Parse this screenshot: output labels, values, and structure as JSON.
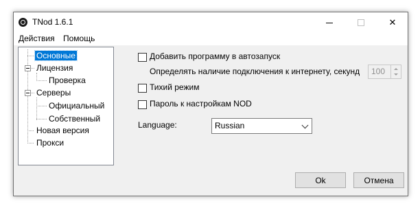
{
  "window": {
    "title": "TNod 1.6.1"
  },
  "menu": {
    "items": [
      "Действия",
      "Помощь"
    ]
  },
  "tree": {
    "items": [
      {
        "label": "Основные",
        "selected": true
      },
      {
        "label": "Лицензия",
        "expanded": true
      },
      {
        "label": "Проверка"
      },
      {
        "label": "Серверы",
        "expanded": true
      },
      {
        "label": "Официальный"
      },
      {
        "label": "Собственный"
      },
      {
        "label": "Новая версия"
      },
      {
        "label": "Прокси"
      }
    ]
  },
  "settings": {
    "autostart_label": "Добавить программу в автозапуск",
    "autostart_checked": false,
    "internet_check_label": "Определять наличие подключения к интернету, секунд",
    "internet_check_value": "100",
    "silent_label": "Тихий режим",
    "silent_checked": false,
    "nod_password_label": "Пароль к настройкам NOD",
    "nod_password_checked": false,
    "language_label": "Language:",
    "language_value": "Russian"
  },
  "buttons": {
    "ok": "Ok",
    "cancel": "Отмена"
  },
  "colors": {
    "selection": "#0078d7",
    "window_bg": "#f0f0f0"
  },
  "icons": [
    "app-icon",
    "minimize-icon",
    "maximize-icon",
    "close-icon",
    "collapse-icon",
    "chevron-down-icon",
    "spin-up-icon",
    "spin-down-icon"
  ]
}
